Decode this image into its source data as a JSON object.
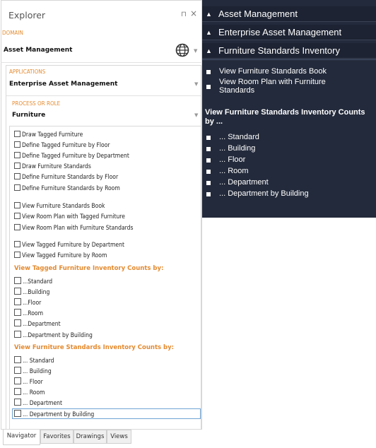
{
  "explorer": {
    "title": "Explorer",
    "pin_glyph": "⊓",
    "close_glyph": "×",
    "domain_label": "DOMAIN",
    "domain_value": "Asset Management",
    "applications_label": "APPLICATIONS",
    "applications_value": "Enterprise Asset Management",
    "process_label": "PROCESS OR ROLE",
    "process_value": "Furniture",
    "items_a": [
      "Draw Tagged Furniture",
      "Define Tagged Furniture by Floor",
      "Define Tagged Furniture by Department",
      "Draw Furniture Standards",
      "Define Furniture Standards by Floor",
      "Define Furniture Standards by Room"
    ],
    "items_b": [
      "View Furniture Standards Book",
      "View Room Plan with Tagged Furniture",
      "View Room Plan with Furniture Standards"
    ],
    "items_c": [
      "View Tagged Furniture by Department",
      "View Tagged Furniture by Room"
    ],
    "group1_head": "View Tagged Furniture Inventory Counts by:",
    "group1_items": [
      "...Standard",
      "...Building",
      "...Floor",
      "...Room",
      "...Department",
      "...Department by Building"
    ],
    "group2_head": "View Furniture Standards Inventory Counts by:",
    "group2_items": [
      "... Standard",
      "... Building",
      "... Floor",
      "... Room",
      "... Department",
      "... Department by Building"
    ],
    "tabs": [
      "Navigator",
      "Favorites",
      "Drawings",
      "Views"
    ]
  },
  "dark_panel": {
    "headers": [
      "Asset Management",
      "Enterprise Asset Management",
      "Furniture Standards Inventory"
    ],
    "items": [
      "View Furniture Standards Book",
      "View Room Plan with Furniture Standards"
    ],
    "group_head": "View Furniture Standards Inventory Counts by ...",
    "group_items": [
      "... Standard",
      "... Building",
      "... Floor",
      "... Room",
      "... Department",
      "... Department by Building"
    ]
  },
  "colors": {
    "accent": "#e48a2f",
    "dark_bg": "#232a3b",
    "selection": "#6fa4d6"
  },
  "icons": [
    "globe-icon",
    "pin-icon",
    "close-icon",
    "dropdown-arrow-icon",
    "collapse-triangle-icon",
    "checkbox-icon",
    "bullet-icon"
  ]
}
